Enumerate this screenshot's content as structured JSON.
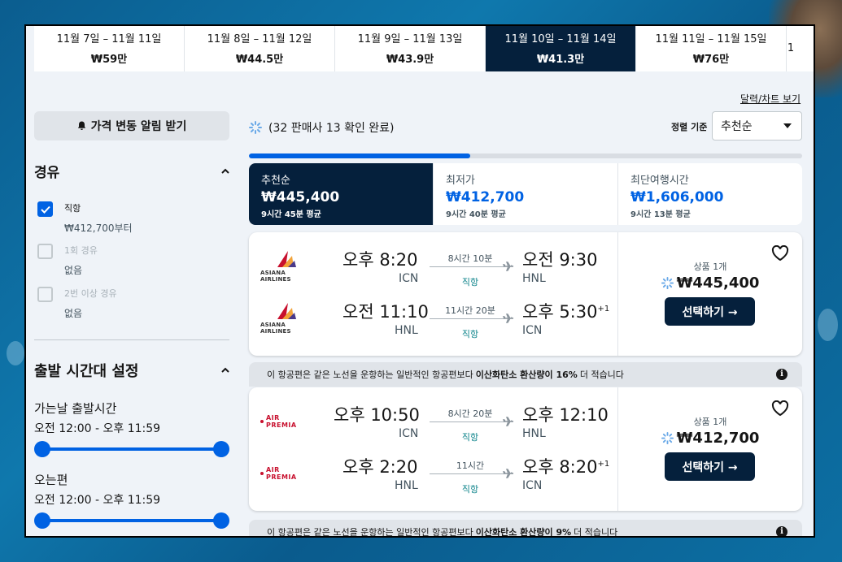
{
  "date_tabs": [
    {
      "range": "11월 7일 – 11월 11일",
      "price": "₩59만"
    },
    {
      "range": "11월 8일 – 11월 12일",
      "price": "₩44.5만"
    },
    {
      "range": "11월 9일 – 11월 13일",
      "price": "₩43.9만"
    },
    {
      "range": "11월 10일 – 11월 14일",
      "price": "₩41.3만"
    },
    {
      "range": "11월 11일 – 11월 15일",
      "price": "₩76만"
    },
    {
      "range": "1",
      "price": ""
    }
  ],
  "selected_date_index": 3,
  "sidebar": {
    "alert_button": "가격 변동 알림 받기",
    "stops_title": "경유",
    "stops": [
      {
        "label": "직항",
        "sub": "₩412,700부터",
        "checked": true
      },
      {
        "label": "1회 경유",
        "sub": "없음",
        "checked": false
      },
      {
        "label": "2번 이상 경유",
        "sub": "없음",
        "checked": false
      }
    ],
    "time_title": "출발 시간대 설정",
    "outbound_label": "가는날 출발시간",
    "outbound_range": "오전 12:00 - 오후 11:59",
    "return_label": "오는편",
    "return_range": "오전 12:00 - 오후 11:59"
  },
  "main": {
    "calendar_link": "달력/차트 보기",
    "status": "(32 판매사 13 확인 완료)",
    "progress": 0.4,
    "sort_label": "정렬 기준",
    "sort_value": "추천순",
    "sort_tabs": [
      {
        "title": "추천순",
        "price": "₩445,400",
        "duration": "9시간 45분 평균"
      },
      {
        "title": "최저가",
        "price": "₩412,700",
        "duration": "9시간 40분 평균"
      },
      {
        "title": "최단여행시간",
        "price": "₩1,606,000",
        "duration": "9시간 13분 평균"
      }
    ],
    "eco_notes": [
      {
        "pre": "이 항공편은 같은 노선을 운항하는 일반적인 항공편보다",
        "bold": "이산화탄소 환산량이 16%",
        "post": "더 적습니다"
      },
      {
        "pre": "이 항공편은 같은 노선을 운항하는 일반적인 항공편보다",
        "bold": "이산화탄소 환산량이 9%",
        "post": "더 적습니다"
      }
    ],
    "info_icon": "i"
  },
  "results": [
    {
      "airline": "ASIANA AIRLINES",
      "legs": [
        {
          "dep_time": "오후 8:20",
          "dep_code": "ICN",
          "duration": "8시간 10분",
          "stops": "직항",
          "arr_time": "오전 9:30",
          "arr_code": "HNL",
          "plus": ""
        },
        {
          "dep_time": "오전 11:10",
          "dep_code": "HNL",
          "duration": "11시간 20분",
          "stops": "직항",
          "arr_time": "오후 5:30",
          "arr_code": "ICN",
          "plus": "+1"
        }
      ],
      "deals": "상품 1개",
      "price": "₩445,400",
      "button": "선택하기 →"
    },
    {
      "airline": "AIR PREMIA",
      "legs": [
        {
          "dep_time": "오후 10:50",
          "dep_code": "ICN",
          "duration": "8시간 20분",
          "stops": "직항",
          "arr_time": "오후 12:10",
          "arr_code": "HNL",
          "plus": ""
        },
        {
          "dep_time": "오후 2:20",
          "dep_code": "HNL",
          "duration": "11시간",
          "stops": "직항",
          "arr_time": "오후 8:20",
          "arr_code": "ICN",
          "plus": "+1"
        }
      ],
      "deals": "상품 1개",
      "price": "₩412,700",
      "button": "선택하기 →"
    }
  ],
  "colors": {
    "navy": "#05203c",
    "accent": "#0062e3",
    "direct": "#0c838a"
  }
}
